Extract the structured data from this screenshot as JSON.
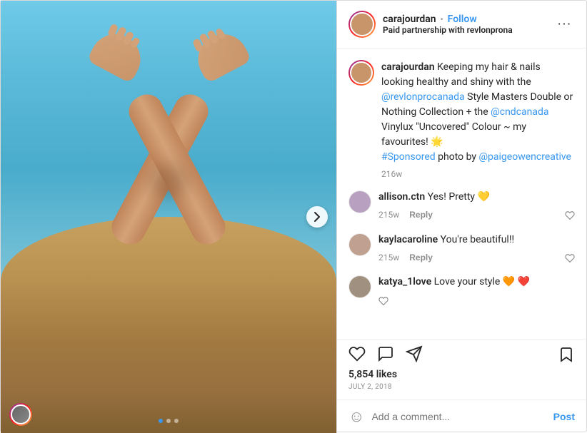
{
  "header": {
    "username": "carajourdan",
    "dot": "•",
    "follow_label": "Follow",
    "partnership": "Paid partnership with ",
    "partner_name": "revlonprona",
    "more_icon": "···"
  },
  "caption": {
    "username": "carajourdan",
    "text": " Keeping my hair & nails looking healthy and shiny with the ",
    "link1": "@revlonprocanada",
    "text2": " Style Masters Double or Nothing Collection + the ",
    "link2": "@cndcanada",
    "text3": " Vinylux \"Uncovered\" Colour ~ my favourites! 🌟",
    "link3": "#Sponsored",
    "text4": " photo by ",
    "link4": "@paigeowencreative",
    "time": "216w"
  },
  "comments": [
    {
      "username": "allison.ctn",
      "text": " Yes! Pretty 💛",
      "time": "215w",
      "reply_label": "Reply",
      "avatar_color": "#b8a0c0"
    },
    {
      "username": "kaylacaroline",
      "text": " You're beautiful!!",
      "time": "215w",
      "reply_label": "Reply",
      "avatar_color": "#c0a090"
    },
    {
      "username": "katya_1love",
      "text": " Love your style 🧡 ❤️",
      "time": "",
      "reply_label": "",
      "avatar_color": "#a09080"
    }
  ],
  "actions": {
    "likes": "5,854 likes",
    "date": "July 2, 2018"
  },
  "add_comment": {
    "placeholder": "Add a comment...",
    "post_label": "Post"
  },
  "image": {
    "dots": [
      true,
      false,
      false
    ],
    "next_arrow": "›"
  }
}
